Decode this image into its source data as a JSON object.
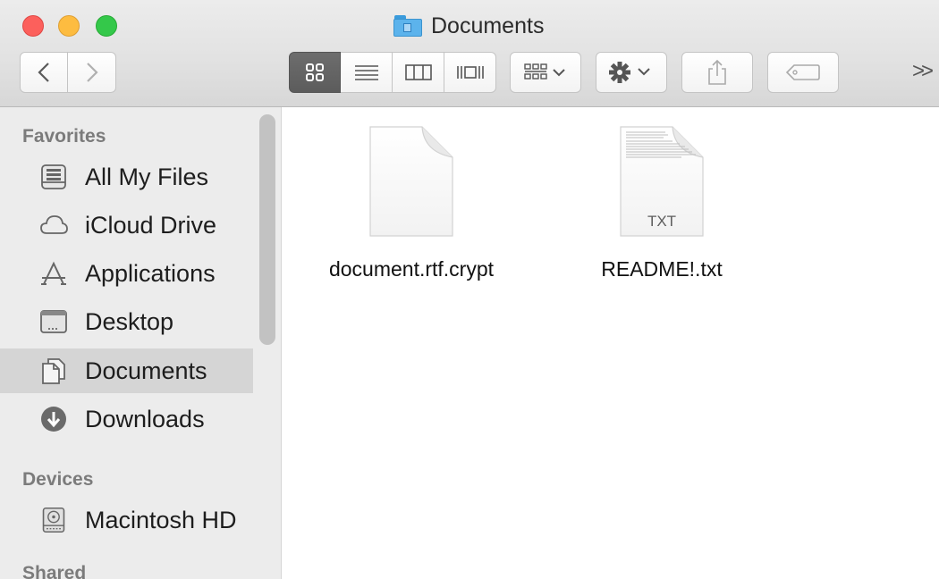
{
  "window": {
    "title": "Documents"
  },
  "toolbar": {
    "more_label": ">>",
    "icons": {
      "back": "chevron-left-icon",
      "forward": "chevron-right-icon",
      "icon_view": "grid-icon",
      "list_view": "list-icon",
      "column_view": "columns-icon",
      "coverflow_view": "coverflow-icon",
      "arrange": "arrange-icon",
      "action": "gear-icon",
      "share": "share-icon",
      "tags": "tag-icon"
    }
  },
  "sidebar": {
    "sections": {
      "favorites": "Favorites",
      "devices": "Devices",
      "shared": "Shared"
    },
    "favorites": [
      {
        "label": "All My Files",
        "icon": "all-my-files-icon"
      },
      {
        "label": "iCloud Drive",
        "icon": "cloud-icon"
      },
      {
        "label": "Applications",
        "icon": "applications-icon"
      },
      {
        "label": "Desktop",
        "icon": "desktop-icon"
      },
      {
        "label": "Documents",
        "icon": "documents-icon",
        "selected": true
      },
      {
        "label": "Downloads",
        "icon": "download-icon"
      }
    ],
    "devices": [
      {
        "label": "Macintosh HD",
        "icon": "hard-drive-icon"
      }
    ]
  },
  "files": [
    {
      "name": "document.rtf.crypt",
      "icon": "blank-document-icon"
    },
    {
      "name": "README!.txt",
      "icon": "text-document-icon",
      "type_label": "TXT"
    }
  ],
  "colors": {
    "close": "#fc605c",
    "minimize": "#fdbc40",
    "zoom": "#34c84a",
    "sidebar_selected": "#d5d5d5",
    "folder_accent": "#5cb3ec"
  }
}
